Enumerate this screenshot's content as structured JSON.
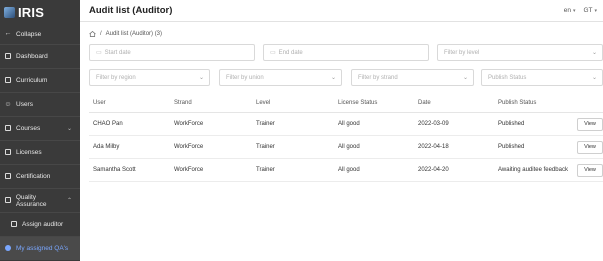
{
  "sidebar": {
    "brand": "IRIS",
    "collapse": "Collapse",
    "items": [
      {
        "label": "Dashboard",
        "icon": "dashboard-icon"
      },
      {
        "label": "Curriculum",
        "icon": "book-icon"
      },
      {
        "label": "Users",
        "icon": "user-icon"
      },
      {
        "label": "Courses",
        "icon": "courses-icon"
      },
      {
        "label": "Licenses",
        "icon": "license-icon"
      },
      {
        "label": "Certification",
        "icon": "certificate-icon"
      },
      {
        "label": "Quality Assurance",
        "icon": "qa-icon"
      },
      {
        "label": "Assign auditor",
        "icon": "assign-icon"
      },
      {
        "label": "My assigned QA's",
        "icon": "qa-dot-icon"
      }
    ],
    "active_color": "#7aa7ff"
  },
  "header": {
    "title": "Audit list (Auditor)",
    "language": "en",
    "user_initials": "GT"
  },
  "breadcrumb": {
    "current": "Audit list (Auditor) (3)"
  },
  "filters": {
    "start_date": "Start date",
    "end_date": "End date",
    "level": "Filter by level",
    "region": "Filter by region",
    "union": "Filter by union",
    "strand": "Filter by strand",
    "publish_status": "Publish Status"
  },
  "table": {
    "columns": [
      "User",
      "Strand",
      "Level",
      "License Status",
      "Date",
      "Publish Status"
    ],
    "view_label": "View",
    "rows": [
      {
        "user": "CHAO Pan",
        "strand": "WorkForce",
        "level": "Trainer",
        "license": "All good",
        "date": "2022-03-09",
        "publish": "Published"
      },
      {
        "user": "Ada Milby",
        "strand": "WorkForce",
        "level": "Trainer",
        "license": "All good",
        "date": "2022-04-18",
        "publish": "Published"
      },
      {
        "user": "Samantha Scott",
        "strand": "WorkForce",
        "level": "Trainer",
        "license": "All good",
        "date": "2022-04-20",
        "publish": "Awaiting auditee feedback"
      }
    ]
  }
}
